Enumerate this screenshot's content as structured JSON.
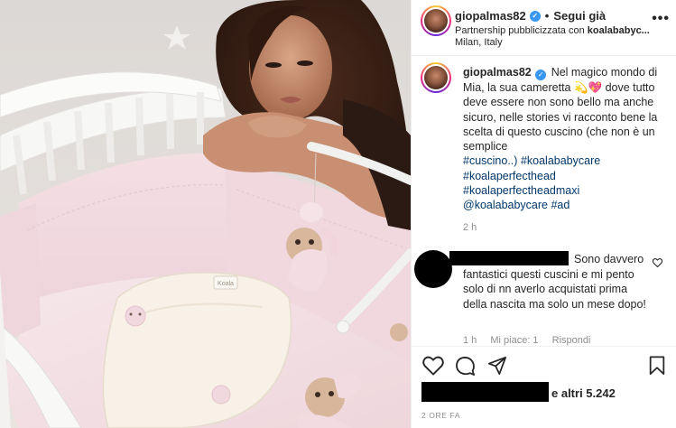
{
  "post": {
    "image_alt": "Woman resting her head on a pink baby crib with a cushion and a plush mobile",
    "brand_tag": "Koala"
  },
  "header": {
    "username": "giopalmas82",
    "separator": "•",
    "follow_label": "Segui già",
    "partnership_prefix": "Partnership pubblicizzata con",
    "partner": "koalababyc...",
    "location": "Milan, Italy",
    "more_label": "•••"
  },
  "caption": {
    "username": "giopalmas82",
    "text": "Nel magico mondo di Mia, la sua cameretta 💫💖 dove tutto deve essere non sono bello ma anche sicuro, nelle stories vi racconto bene la scelta di questo cuscino (che non è un semplice",
    "hashtags": [
      "#cuscino..)",
      "#koalababycare",
      "#koalaperfecthead",
      "#koalaperfectheadmaxi",
      "@koalababycare",
      "#ad"
    ],
    "time": "2 h"
  },
  "comment": {
    "text_first": "Sono",
    "text_rest": "davvero fantastici questi cuscini e mi pento solo di nn averlo acquistati prima della nascita ma solo un mese dopo!",
    "time": "1 h",
    "likes": "Mi piace: 1",
    "reply": "Rispondi"
  },
  "actions": {
    "likes_suffix": "e altri 5.242",
    "time_ago": "2 ORE FA"
  },
  "colors": {
    "accent_blue": "#3897f0",
    "hashtag": "#00376b",
    "muted": "#8e8e8e",
    "crib_pink": "#f3dde2"
  }
}
